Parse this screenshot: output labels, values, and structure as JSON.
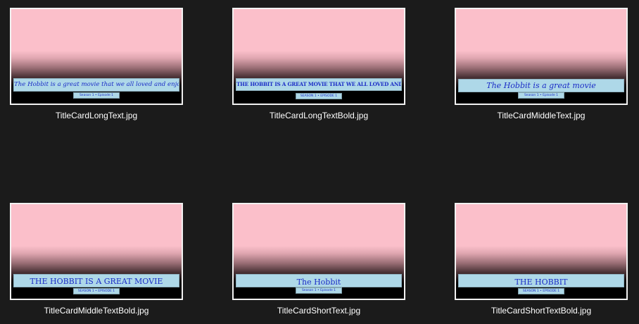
{
  "files": [
    {
      "name": "TitleCardLongText.jpg",
      "thumb_title": "The Hobbit is a great movie that we all loved and enjoyed watching",
      "thumb_subtitle": "Season 1 • Episode 1"
    },
    {
      "name": "TitleCardLongTextBold.jpg",
      "thumb_title": "THE HOBBIT IS A GREAT MOVIE THAT WE ALL LOVED AND ENJOYED WATCHING",
      "thumb_subtitle": "SEASON 1 • EPISODE 1"
    },
    {
      "name": "TitleCardMiddleText.jpg",
      "thumb_title": "The Hobbit is a great movie",
      "thumb_subtitle": "Season 1 • Episode 1"
    },
    {
      "name": "TitleCardMiddleTextBold.jpg",
      "thumb_title": "THE HOBBIT IS A GREAT MOVIE",
      "thumb_subtitle": "SEASON 1 • EPISODE 1"
    },
    {
      "name": "TitleCardShortText.jpg",
      "thumb_title": "The Hobbit",
      "thumb_subtitle": "Season 1 • Episode 1"
    },
    {
      "name": "TitleCardShortTextBold.jpg",
      "thumb_title": "THE HOBBIT",
      "thumb_subtitle": "SEASON 1 • EPISODE 1"
    }
  ],
  "colors": {
    "background": "#1b1b1b",
    "thumb_pink": "#fbbfca",
    "title_bar": "#aed8e8",
    "title_text": "#1a2bc6",
    "filename_text": "#ffffff"
  }
}
